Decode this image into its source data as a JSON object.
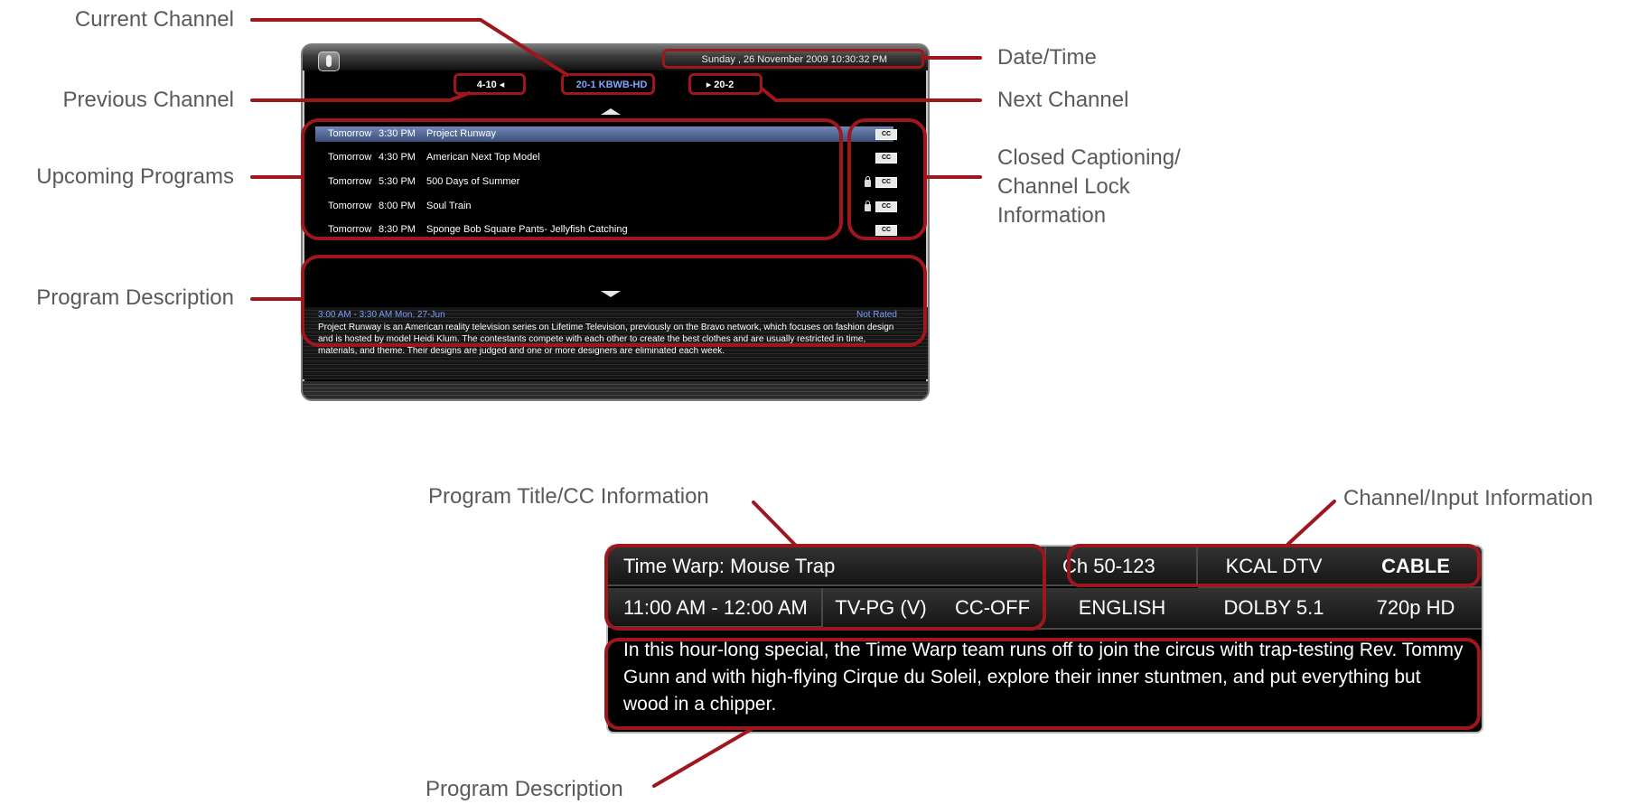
{
  "callouts": {
    "current_channel": "Current Channel",
    "previous_channel": "Previous Channel",
    "upcoming_programs": "Upcoming Programs",
    "program_description_top": "Program Description",
    "date_time": "Date/Time",
    "next_channel": "Next Channel",
    "cc_line1": "Closed Captioning/",
    "cc_line2": "Channel Lock",
    "cc_line3": "Information",
    "program_title_cc": "Program Title/CC Information",
    "channel_input": "Channel/Input Information",
    "program_description_bottom": "Program Description"
  },
  "guide_panel": {
    "date_time": "Sunday , 26 November 2009 10:30:32 PM",
    "previous_channel": "4-10",
    "current_channel": "20-1 KBWB-HD",
    "next_channel": "20-2",
    "programs": [
      {
        "day": "Tomorrow",
        "time": "3:30 PM",
        "title": "Project Runway",
        "locked": false,
        "cc": "CC"
      },
      {
        "day": "Tomorrow",
        "time": "4:30 PM",
        "title": "American Next Top Model",
        "locked": false,
        "cc": "CC"
      },
      {
        "day": "Tomorrow",
        "time": "5:30 PM",
        "title": "500 Days of Summer",
        "locked": true,
        "cc": "CC"
      },
      {
        "day": "Tomorrow",
        "time": "8:00 PM",
        "title": "Soul Train",
        "locked": true,
        "cc": "CC"
      },
      {
        "day": "Tomorrow",
        "time": "8:30 PM",
        "title": "Sponge Bob Square Pants- Jellyfish Catching",
        "locked": false,
        "cc": "CC"
      }
    ],
    "description_time": "3:00 AM - 3:30 AM Mon. 27-Jun",
    "description_rating": "Not Rated",
    "description_text": "Project Runway is an American reality television series on Lifetime Television, previously on the Bravo network, which focuses on fashion design and is hosted by model Heidi Klum. The contestants compete with each other to create the best clothes and are usually restricted in time, materials, and theme. Their designs are judged and one or more designers are eliminated each week."
  },
  "info_banner": {
    "title": "Time Warp: Mouse Trap",
    "time": "11:00 AM - 12:00 AM",
    "rating": "TV-PG (V)",
    "cc_status": "CC-OFF",
    "channel": "Ch 50-123",
    "station": "KCAL DTV",
    "input": "CABLE",
    "language": "ENGLISH",
    "audio": "DOLBY 5.1",
    "resolution": "720p HD",
    "description": "In this hour-long special, the Time Warp team runs off to join the circus with trap-testing Rev. Tommy Gunn and with high-flying Cirque du Soleil, explore their inner stuntmen, and put everything but wood in a chipper."
  },
  "colors": {
    "highlight": "#a0161d",
    "label_text": "#5a5a5a",
    "selected_row": "#5a70a0",
    "accent_blue": "#86a3ff"
  }
}
